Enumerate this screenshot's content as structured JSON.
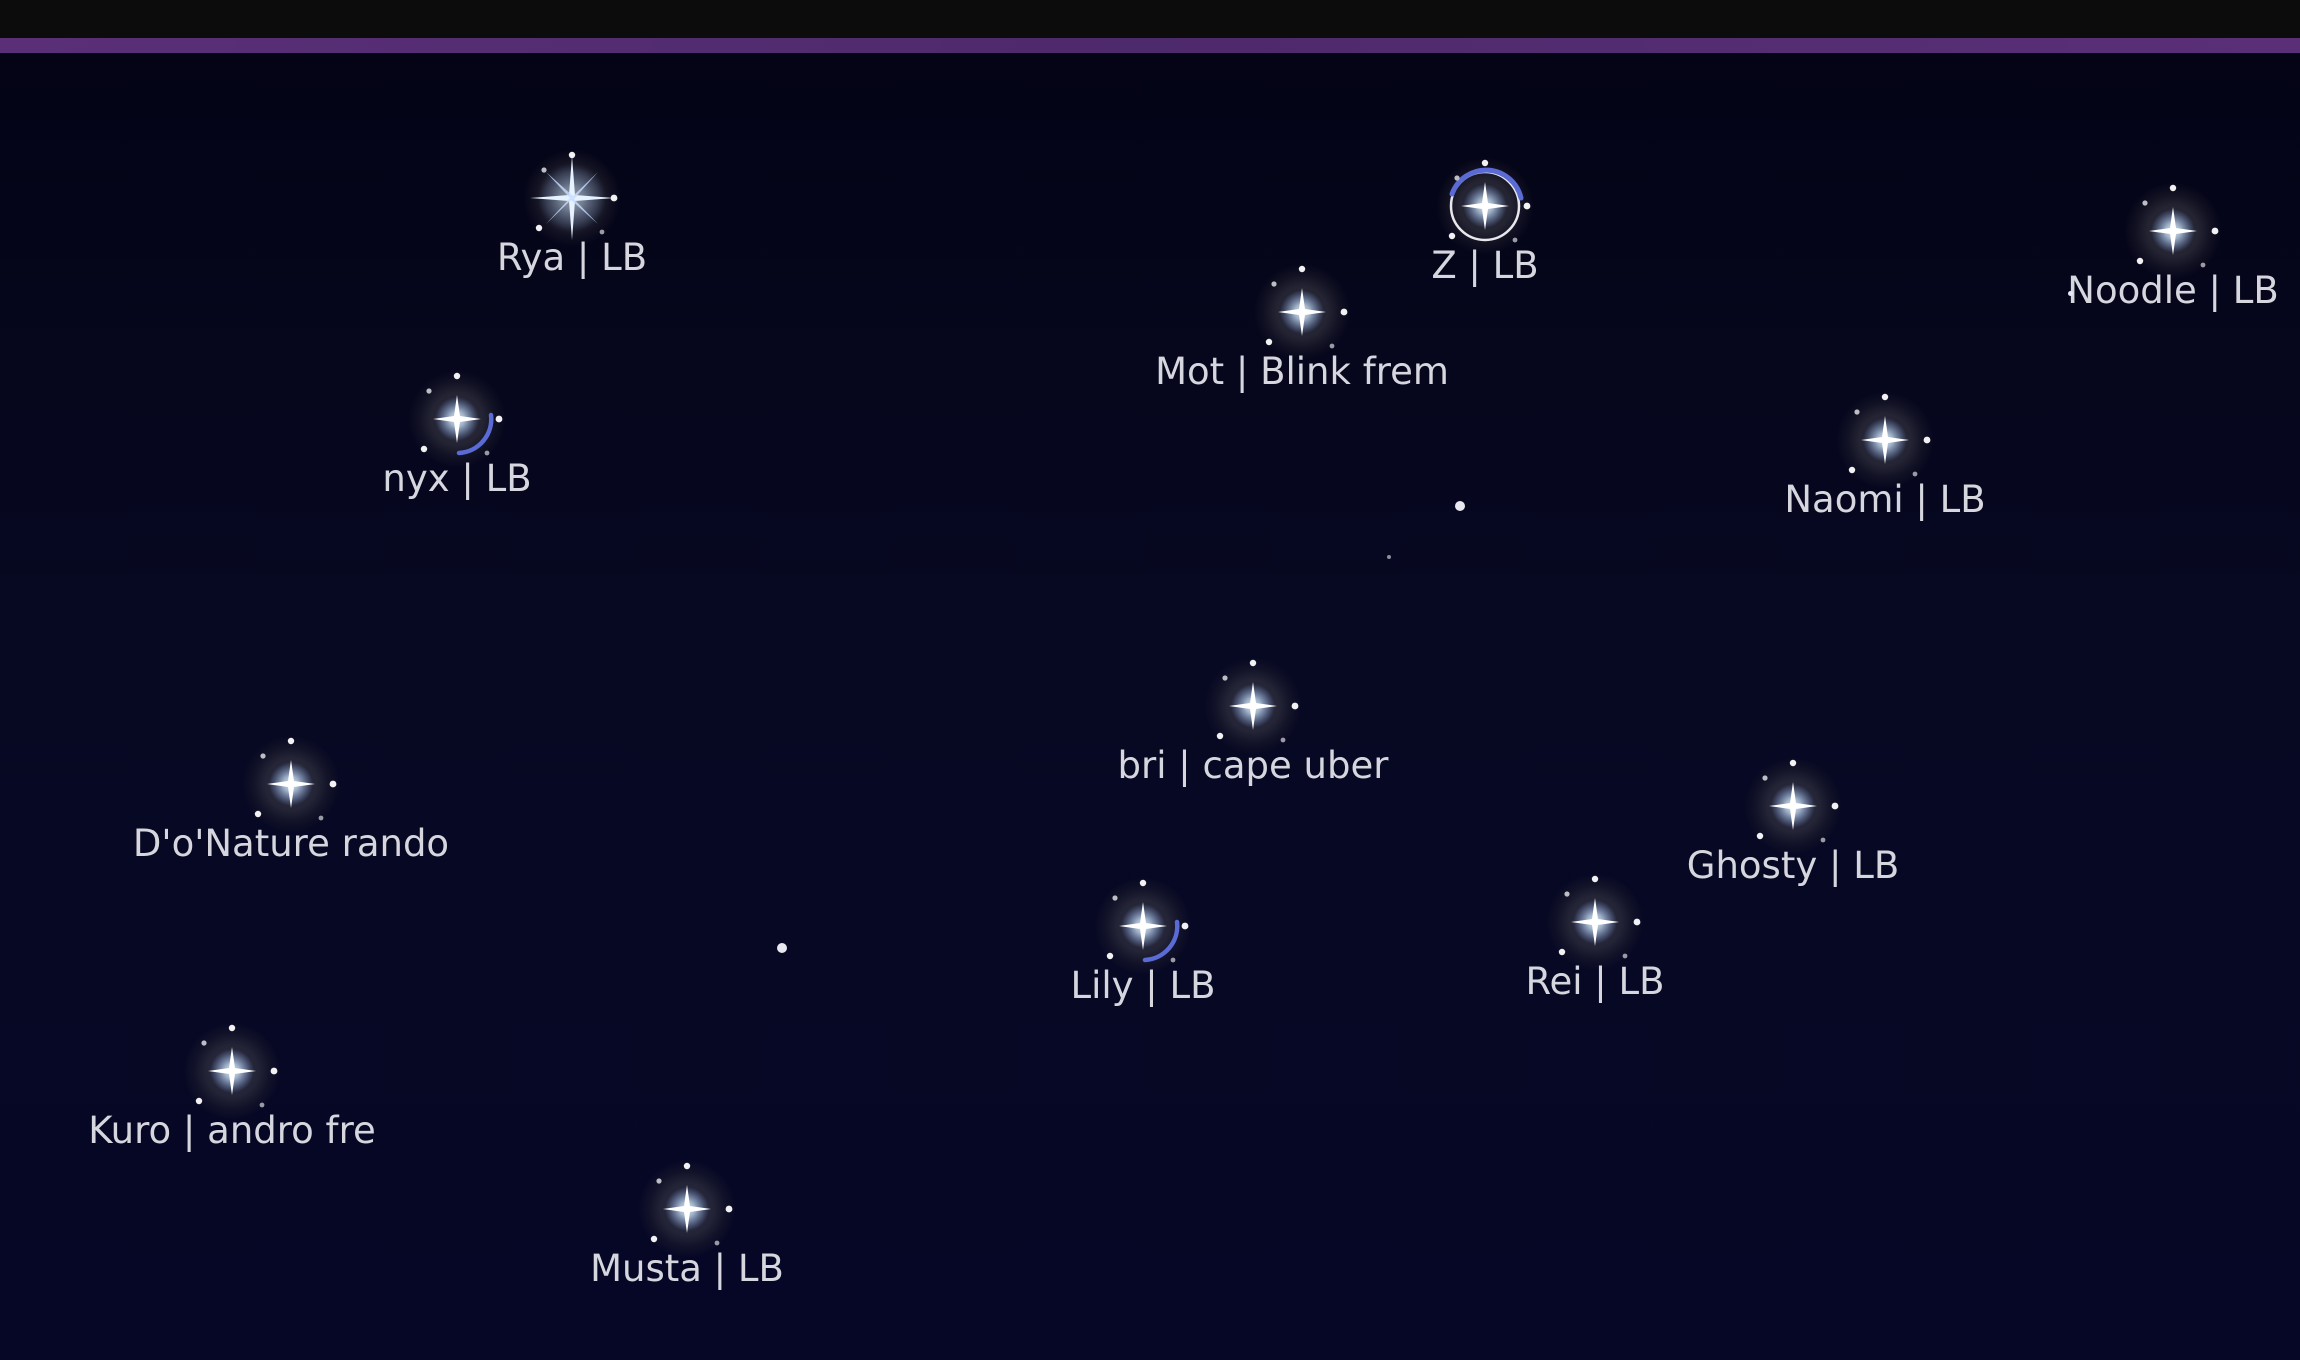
{
  "colors": {
    "background": "#05061a",
    "top_bar": "#0c0c0c",
    "accent_line": "#5a2f78",
    "label_text": "#d6d6de",
    "star_core": "#ffffff",
    "orbit_arc": "#5b6bd6"
  },
  "stars": [
    {
      "id": "rya",
      "label": "Rya | LB",
      "style": "flare"
    },
    {
      "id": "z",
      "label": "Z | LB",
      "style": "ring-arc"
    },
    {
      "id": "noodle",
      "label": "Noodle | LB",
      "style": "orb"
    },
    {
      "id": "mot",
      "label": "Mot | Blink frem",
      "style": "orb"
    },
    {
      "id": "nyx",
      "label": "nyx | LB",
      "style": "orb-arc"
    },
    {
      "id": "naomi",
      "label": "Naomi | LB",
      "style": "orb"
    },
    {
      "id": "bri",
      "label": "bri | cape uber",
      "style": "orb"
    },
    {
      "id": "donature",
      "label": "D'o'Nature rando",
      "style": "orb"
    },
    {
      "id": "ghosty",
      "label": "Ghosty | LB",
      "style": "orb"
    },
    {
      "id": "lily",
      "label": "Lily | LB",
      "style": "orb-arc"
    },
    {
      "id": "rei",
      "label": "Rei | LB",
      "style": "orb"
    },
    {
      "id": "kuro",
      "label": "Kuro | andro fre",
      "style": "orb"
    },
    {
      "id": "musta",
      "label": "Musta | LB",
      "style": "orb"
    }
  ]
}
